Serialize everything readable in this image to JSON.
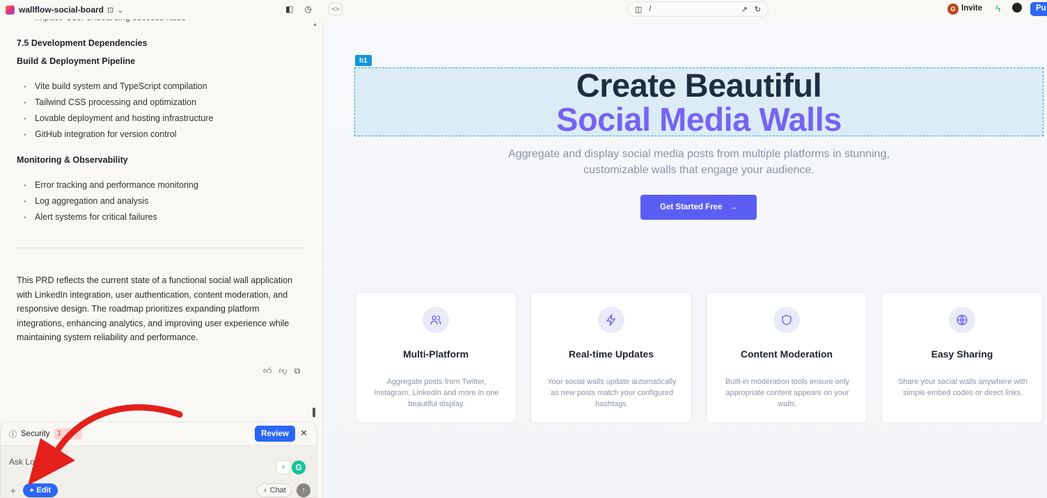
{
  "project": {
    "name": "wallflow-social-board",
    "lock_glyph": "🔒",
    "chevron": "⌄"
  },
  "doc": {
    "cut_line": "Impact: User onboarding success rates",
    "section_title": "7.5 Development Dependencies",
    "build_title": "Build & Deployment Pipeline",
    "build_items": [
      "Vite build system and TypeScript compilation",
      "Tailwind CSS processing and optimization",
      "Lovable deployment and hosting infrastructure",
      "GitHub integration for version control"
    ],
    "monitor_title": "Monitoring & Observability",
    "monitor_items": [
      "Error tracking and performance monitoring",
      "Log aggregation and analysis",
      "Alert systems for critical failures"
    ],
    "summary": "This PRD reflects the current state of a functional social wall application with LinkedIn integration, user authentication, content moderation, and responsive design. The roadmap prioritizes expanding platform integrations, enhancing analytics, and improving user experience while maintaining system reliability and performance."
  },
  "security": {
    "label": "Security",
    "badge": "1",
    "review_label": "Review",
    "close": "✕"
  },
  "composer": {
    "placeholder": "Ask Lovable...",
    "visible_text": "Ask Lov",
    "edit_label": "Edit",
    "chat_label": "Chat"
  },
  "topbar": {
    "url_path": "/",
    "invite_label": "Invite",
    "avatar_letter": "G",
    "publish_label": "Pu"
  },
  "preview": {
    "h1_tag": "h1",
    "hero_line1": "Create Beautiful",
    "hero_line2": "Social Media Walls",
    "subtitle": "Aggregate and display social media posts from multiple platforms in stunning, customizable walls that engage your audience.",
    "cta_label": "Get Started Free",
    "cards": [
      {
        "title": "Multi-Platform",
        "desc": "Aggregate posts from Twitter, Instagram, LinkedIn and more in one beautiful display.",
        "icon": "users-icon"
      },
      {
        "title": "Real-time Updates",
        "desc": "Your social walls update automatically as new posts match your configured hashtags.",
        "icon": "bolt-icon"
      },
      {
        "title": "Content Moderation",
        "desc": "Built-in moderation tools ensure only appropriate content appears on your walls.",
        "icon": "shield-icon"
      },
      {
        "title": "Easy Sharing",
        "desc": "Share your social walls anywhere with simple embed codes or direct links.",
        "icon": "globe-icon"
      }
    ]
  },
  "colors": {
    "accent": "#5b5ef2",
    "hero_dark": "#1e2d40",
    "hero_purple": "#7663f2",
    "review_blue": "#2b66f6",
    "arrow_red": "#e3201b"
  }
}
